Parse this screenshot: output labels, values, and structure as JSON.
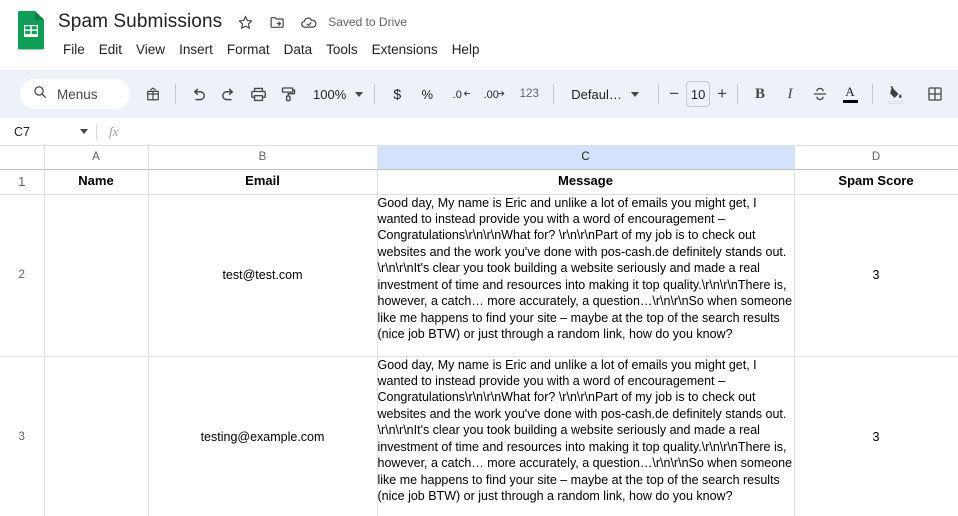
{
  "titlebar": {
    "doc_title": "Spam Submissions",
    "logo_icon": "sheets-logo-icon",
    "star_icon": "star-icon",
    "move_folder_icon": "move-to-folder-icon",
    "cloud_icon": "cloud-saved-icon",
    "save_status": "Saved to Drive",
    "brand_color": "#0f9d58"
  },
  "menubar": {
    "items": [
      {
        "label": "File"
      },
      {
        "label": "Edit"
      },
      {
        "label": "View"
      },
      {
        "label": "Insert"
      },
      {
        "label": "Format"
      },
      {
        "label": "Data"
      },
      {
        "label": "Tools"
      },
      {
        "label": "Extensions"
      },
      {
        "label": "Help"
      }
    ]
  },
  "toolbar": {
    "menus_label": "Menus",
    "search_icon": "search-icon",
    "ai_icon": "sheets-assistant-icon",
    "undo_icon": "undo-icon",
    "redo_icon": "redo-icon",
    "print_icon": "print-icon",
    "paint_format_icon": "paint-format-icon",
    "zoom_value": "100%",
    "currency_label": "$",
    "percent_label": "%",
    "decrease_decimal_label": ".0",
    "increase_decimal_label": ".00",
    "more_formats_label": "123",
    "font_family": "Defaul…",
    "font_size": "10",
    "decrease_size_label": "−",
    "increase_size_label": "+",
    "bold_label": "B",
    "italic_label": "I",
    "strikethrough_icon": "strikethrough-icon",
    "text_color_label": "A",
    "fill_color_icon": "fill-color-icon",
    "borders_icon": "borders-icon",
    "background_color": "#edf2fa"
  },
  "formulabar": {
    "cell_reference": "C7",
    "fx_label": "fx",
    "formula_value": ""
  },
  "grid": {
    "columns": [
      {
        "letter": "A",
        "selected": false
      },
      {
        "letter": "B",
        "selected": false
      },
      {
        "letter": "C",
        "selected": true
      },
      {
        "letter": "D",
        "selected": false
      }
    ],
    "selection_color": "#d3e3fd",
    "header_row": {
      "row_number": "1",
      "cells": [
        "Name",
        "Email",
        "Message",
        "Spam Score"
      ]
    },
    "rows": [
      {
        "row_number": "2",
        "name": "",
        "email": "test@test.com",
        "message": "Good day, My name is Eric and unlike a lot of emails you might get, I wanted to instead provide you with a word of encouragement – Congratulations\\r\\n\\r\\nWhat for? \\r\\n\\r\\nPart of my job is to check out websites and the work you've done with pos-cash.de definitely stands out. \\r\\n\\r\\nIt's clear you took building a website seriously and made a real investment of time and resources into making it top quality.\\r\\n\\r\\nThere is, however, a catch… more accurately, a question…\\r\\n\\r\\nSo when someone like me happens to find your site – maybe at the top of the search results (nice job BTW) or just through a random link, how do you know?",
        "spam_score": "3"
      },
      {
        "row_number": "3",
        "name": "",
        "email": "testing@example.com",
        "message": "Good day, My name is Eric and unlike a lot of emails you might get, I wanted to instead provide you with a word of encouragement – Congratulations\\r\\n\\r\\nWhat for? \\r\\n\\r\\nPart of my job is to check out websites and the work you've done with pos-cash.de definitely stands out. \\r\\n\\r\\nIt's clear you took building a website seriously and made a real investment of time and resources into making it top quality.\\r\\n\\r\\nThere is, however, a catch… more accurately, a question…\\r\\n\\r\\nSo when someone like me happens to find your site – maybe at the top of the search results (nice job BTW) or just through a random link, how do you know?",
        "spam_score": "3"
      }
    ]
  }
}
